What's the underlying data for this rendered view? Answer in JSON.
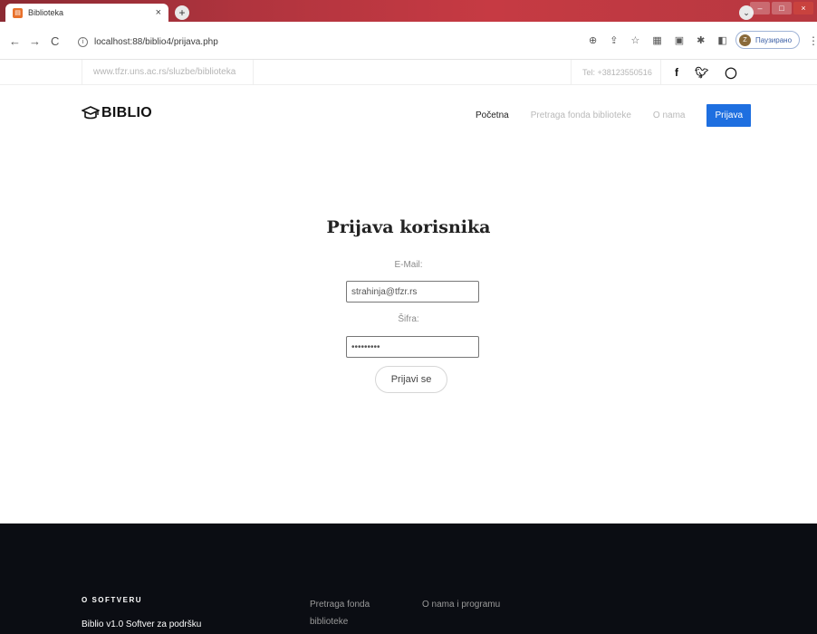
{
  "browser": {
    "tab_title": "Biblioteka",
    "tab_close": "×",
    "new_tab": "+",
    "url": "localhost:88/biblio4/prijava.php",
    "profile_initial": "Z",
    "profile_label": "Паузирано",
    "back": "←",
    "forward": "→",
    "reload": "C"
  },
  "infobar": {
    "site_url": "www.tfzr.uns.ac.rs/sluzbe/biblioteka",
    "phone": "Tel: +38123550516"
  },
  "navbar": {
    "brand": "BIBLIO",
    "items": [
      {
        "label": "Početna"
      },
      {
        "label": "Pretraga fonda biblioteke"
      },
      {
        "label": "O nama"
      }
    ],
    "login_label": "Prijava"
  },
  "login": {
    "title": "Prijava korisnika",
    "email_label": "E-Mail:",
    "email_value": "strahinja@tfzr.rs",
    "password_label": "Šifra:",
    "password_value": "•••••••••",
    "submit_label": "Prijavi se"
  },
  "footer": {
    "heading": "O SOFTVERU",
    "description": "Biblio v1.0 Softver za podršku",
    "link_search": "Pretraga fonda biblioteke",
    "link_about": "O nama i programu"
  },
  "colors": {
    "accent": "#1e6fe0",
    "footer_bg": "#0b0d13"
  }
}
